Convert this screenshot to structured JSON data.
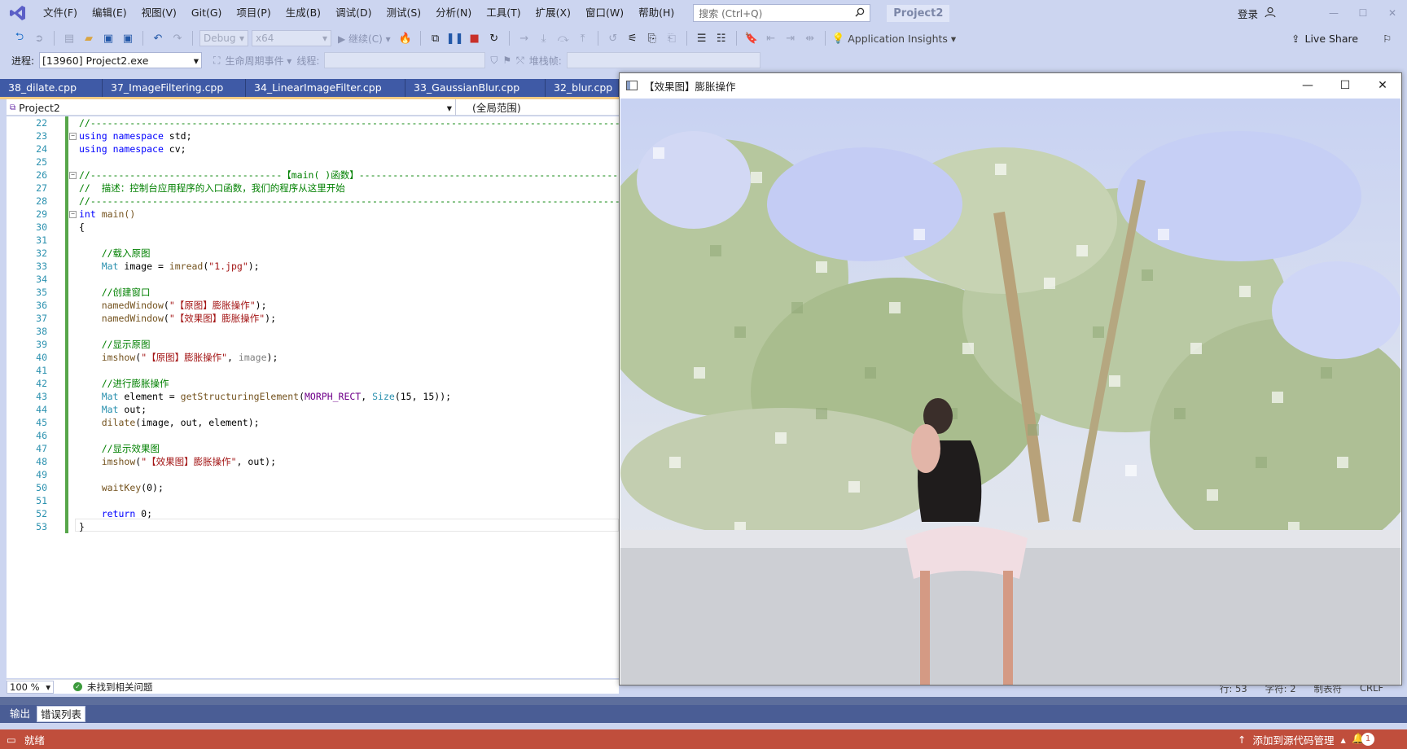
{
  "menu": {
    "items": [
      "文件(F)",
      "编辑(E)",
      "视图(V)",
      "Git(G)",
      "项目(P)",
      "生成(B)",
      "调试(D)",
      "测试(S)",
      "分析(N)",
      "工具(T)",
      "扩展(X)",
      "窗口(W)",
      "帮助(H)"
    ],
    "search_placeholder": "搜索 (Ctrl+Q)",
    "solution_name": "Project2",
    "login": "登录"
  },
  "toolbar": {
    "config": "Debug",
    "platform": "x64",
    "continue": "继续(C)",
    "app_insights": "Application Insights",
    "live_share": "Live Share"
  },
  "debug_bar": {
    "process_label": "进程:",
    "process_value": "[13960] Project2.exe",
    "lifecycle": "生命周期事件",
    "thread_label": "线程:",
    "stack_label": "堆栈帧:"
  },
  "tabs": [
    "38_dilate.cpp",
    "37_ImageFiltering.cpp",
    "34_LinearImageFilter.cpp",
    "33_GaussianBlur.cpp",
    "32_blur.cpp"
  ],
  "navbar": {
    "project": "Project2",
    "scope": "(全局范围)"
  },
  "editor": {
    "line_numbers": [
      "22",
      "23",
      "24",
      "25",
      "26",
      "27",
      "28",
      "29",
      "30",
      "31",
      "32",
      "33",
      "34",
      "35",
      "36",
      "37",
      "38",
      "39",
      "40",
      "41",
      "42",
      "43",
      "44",
      "45",
      "46",
      "47",
      "48",
      "49",
      "50",
      "51",
      "52",
      "53"
    ],
    "zoom": "100 %",
    "issues": "未找到相关问题",
    "cursor_line": "行: 53",
    "cursor_char": "字符: 2",
    "indent": "制表符",
    "line_ending": "CRLF"
  },
  "code": {
    "l22": "//-----------------------------------------------------------------------------------------------",
    "l23_kw1": "using",
    "l23_kw2": "namespace",
    "l23_rest": " std;",
    "l24_kw1": "using",
    "l24_kw2": "namespace",
    "l24_rest": " cv;",
    "l26_a": "//----------------------------------【main( )函数】",
    "l26_b": "-------------------------------------------------",
    "l27": "//  描述：控制台应用程序的入口函数，我们的程序从这里开始",
    "l28": "//-----------------------------------------------------------------------------------------------",
    "l29_kw": "int",
    "l29_rest": " main()",
    "l30": "{",
    "l32": "    //载入原图",
    "l33_ty": "Mat",
    "l33_a": " image = ",
    "l33_fn": "imread",
    "l33_b": "(",
    "l33_st": "\"1.jpg\"",
    "l33_c": ");",
    "l35": "    //创建窗口",
    "l36_fn": "namedWindow",
    "l36_st": "\"【原图】膨胀操作\"",
    "l36_c": ");",
    "l37_fn": "namedWindow",
    "l37_st": "\"【效果图】膨胀操作\"",
    "l37_c": ");",
    "l39": "    //显示原图",
    "l40_fn": "imshow",
    "l40_st": "\"【原图】膨胀操作\"",
    "l40_b": ", ",
    "l40_pm": "image",
    "l40_c": ");",
    "l42": "    //进行膨胀操作",
    "l43_ty": "Mat",
    "l43_a": " element = ",
    "l43_fn": "getStructuringElement",
    "l43_mc": "MORPH_RECT",
    "l43_b": ", ",
    "l43_ty2": "Size",
    "l43_c": "(15, 15));",
    "l44_ty": "Mat",
    "l44_a": " out;",
    "l45_fn": "dilate",
    "l45_a": "(image, out, element);",
    "l47": "    //显示效果图",
    "l48_fn": "imshow",
    "l48_st": "\"【效果图】膨胀操作\"",
    "l48_b": ", out);",
    "l50_fn": "waitKey",
    "l50_a": "(0);",
    "l52_kw": "return",
    "l52_a": " 0;",
    "l53": "}"
  },
  "panel_tabs": [
    "输出",
    "错误列表"
  ],
  "status": {
    "ready": "就绪",
    "source_control": "添加到源代码管理",
    "notifications": "1"
  },
  "cv_window": {
    "title": "【效果图】膨胀操作"
  },
  "colors": {
    "status_bar": "#c04e3c",
    "tab_strip": "#3f5aa6",
    "chrome": "#ccd5f0",
    "change_bar": "#57a64a"
  }
}
